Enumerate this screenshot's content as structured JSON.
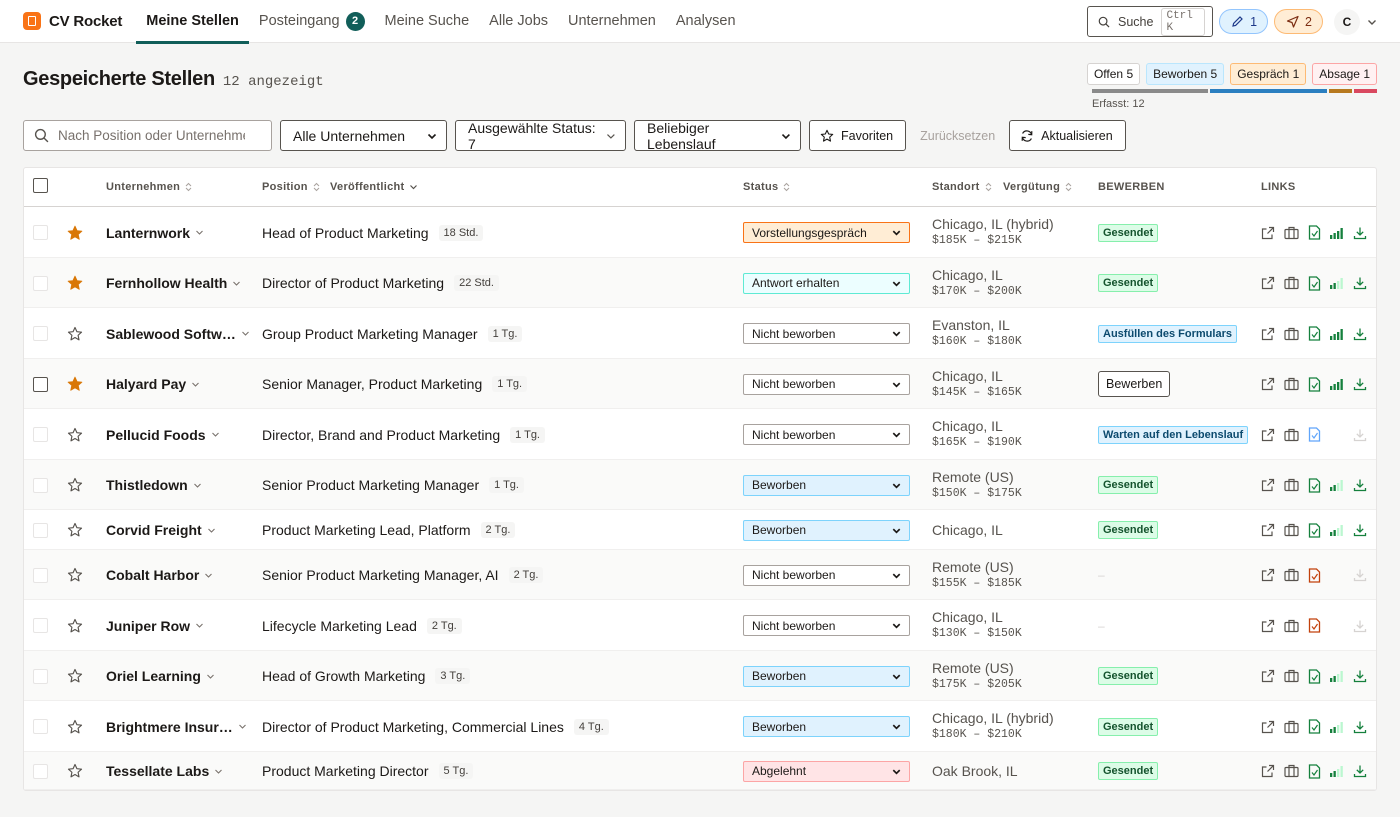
{
  "app": {
    "name": "CV Rocket"
  },
  "nav": {
    "tabs": [
      {
        "label": "Meine Stellen"
      },
      {
        "label": "Posteingang",
        "badge": "2"
      },
      {
        "label": "Meine Suche"
      },
      {
        "label": "Alle Jobs"
      },
      {
        "label": "Unternehmen"
      },
      {
        "label": "Analysen"
      }
    ],
    "search_label": "Suche",
    "search_kbd": "Ctrl K",
    "drafts_count": "1",
    "sent_count": "2",
    "avatar_initial": "C"
  },
  "header": {
    "title": "Gespeicherte Stellen",
    "count": "12 angezeigt",
    "status_pills": [
      {
        "label": "Offen",
        "count": "5"
      },
      {
        "label": "Beworben",
        "count": "5"
      },
      {
        "label": "Gespräch",
        "count": "1"
      },
      {
        "label": "Absage",
        "count": "1"
      }
    ],
    "status_bar_colors": [
      "#8a8a8a",
      "#2b7fc0",
      "#b7791f",
      "#d9485f"
    ],
    "erfasst": "Erfasst: 12"
  },
  "filters": {
    "search_placeholder": "Nach Position oder Unternehmen",
    "company": "Alle Unternehmen",
    "status": "Ausgewählte Status: 7",
    "resume": "Beliebiger Lebenslauf",
    "favorites": "Favoriten",
    "reset": "Zurücksetzen",
    "refresh": "Aktualisieren"
  },
  "table": {
    "headers": {
      "company": "Unternehmen",
      "position": "Position",
      "published": "Veröffentlicht",
      "status": "Status",
      "location": "Standort",
      "salary": "Vergütung",
      "apply": "BEWERBEN",
      "links": "LINKS"
    },
    "rows": [
      {
        "company": "Lanternwork",
        "starred": true,
        "position": "Head of Product Marketing",
        "age": "18 Std.",
        "status": "Vorstellungsgespräch",
        "status_kind": "interview",
        "location": "Chicago, IL (hybrid)",
        "salary": "$185K – $215K",
        "apply": "Gesendet",
        "apply_kind": "sent",
        "resume_color": "#15803d",
        "signal_strength": "4 of 4 bars",
        "download": true
      },
      {
        "company": "Fernhollow Health",
        "starred": true,
        "position": "Director of Product Marketing",
        "age": "22 Std.",
        "status": "Antwort erhalten",
        "status_kind": "response",
        "location": "Chicago, IL",
        "salary": "$170K – $200K",
        "apply": "Gesendet",
        "apply_kind": "sent",
        "resume_color": "#15803d",
        "signal_strength": "2 of 4 bars",
        "download": true
      },
      {
        "company": "Sablewood Softw…",
        "starred": false,
        "position": "Group Product Marketing Manager",
        "age": "1 Tg.",
        "status": "Nicht beworben",
        "status_kind": "none",
        "location": "Evanston, IL",
        "salary": "$160K – $180K",
        "apply": "Ausfüllen des Formulars",
        "apply_kind": "fill",
        "resume_color": "#15803d",
        "signal_strength": "4 of 4 bars",
        "download": true
      },
      {
        "company": "Halyard Pay",
        "starred": true,
        "position": "Senior Manager, Product Marketing",
        "age": "1 Tg.",
        "status": "Nicht beworben",
        "status_kind": "none",
        "location": "Chicago, IL",
        "salary": "$145K – $165K",
        "apply": "Bewerben",
        "apply_kind": "button",
        "resume_color": "#15803d",
        "signal_strength": "4 of 4 bars",
        "download": true
      },
      {
        "company": "Pellucid Foods",
        "starred": false,
        "position": "Director, Brand and Product Marketing",
        "age": "1 Tg.",
        "status": "Nicht beworben",
        "status_kind": "none",
        "location": "Chicago, IL",
        "salary": "$165K – $190K",
        "apply": "Warten auf den Lebenslauf",
        "apply_kind": "wait",
        "resume_color": "#60a5fa",
        "signal_strength": "",
        "download": false
      },
      {
        "company": "Thistledown",
        "starred": false,
        "position": "Senior Product Marketing Manager",
        "age": "1 Tg.",
        "status": "Beworben",
        "status_kind": "applied",
        "location": "Remote (US)",
        "salary": "$150K – $175K",
        "apply": "Gesendet",
        "apply_kind": "sent",
        "resume_color": "#15803d",
        "signal_strength": "2 of 4 bars",
        "download": true
      },
      {
        "company": "Corvid Freight",
        "starred": false,
        "position": "Product Marketing Lead, Platform",
        "age": "2 Tg.",
        "status": "Beworben",
        "status_kind": "applied",
        "location": "Chicago, IL",
        "salary": "",
        "apply": "Gesendet",
        "apply_kind": "sent",
        "resume_color": "#15803d",
        "signal_strength": "2 of 4 bars",
        "download": true
      },
      {
        "company": "Cobalt Harbor",
        "starred": false,
        "position": "Senior Product Marketing Manager, AI",
        "age": "2 Tg.",
        "status": "Nicht beworben",
        "status_kind": "none",
        "location": "Remote (US)",
        "salary": "$155K – $185K",
        "apply": "–",
        "apply_kind": "none",
        "resume_color": "#c2410c",
        "signal_strength": "",
        "download": false
      },
      {
        "company": "Juniper Row",
        "starred": false,
        "position": "Lifecycle Marketing Lead",
        "age": "2 Tg.",
        "status": "Nicht beworben",
        "status_kind": "none",
        "location": "Chicago, IL",
        "salary": "$130K – $150K",
        "apply": "–",
        "apply_kind": "none",
        "resume_color": "#c2410c",
        "signal_strength": "",
        "download": false
      },
      {
        "company": "Oriel Learning",
        "starred": false,
        "position": "Head of Growth Marketing",
        "age": "3 Tg.",
        "status": "Beworben",
        "status_kind": "applied",
        "location": "Remote (US)",
        "salary": "$175K – $205K",
        "apply": "Gesendet",
        "apply_kind": "sent",
        "resume_color": "#15803d",
        "signal_strength": "2 of 4 bars",
        "download": true
      },
      {
        "company": "Brightmere Insur…",
        "starred": false,
        "position": "Director of Product Marketing, Commercial Lines",
        "age": "4 Tg.",
        "status": "Beworben",
        "status_kind": "applied",
        "location": "Chicago, IL (hybrid)",
        "salary": "$180K – $210K",
        "apply": "Gesendet",
        "apply_kind": "sent",
        "resume_color": "#15803d",
        "signal_strength": "2 of 4 bars",
        "download": true
      },
      {
        "company": "Tessellate Labs",
        "starred": false,
        "position": "Product Marketing Director",
        "age": "5 Tg.",
        "status": "Abgelehnt",
        "status_kind": "rejected",
        "location": "Oak Brook, IL",
        "salary": "",
        "apply": "Gesendet",
        "apply_kind": "sent",
        "resume_color": "#15803d",
        "signal_strength": "2 of 4 bars",
        "download": true
      }
    ]
  },
  "colors": {
    "accent": "#115e59",
    "star": "#d97706"
  }
}
